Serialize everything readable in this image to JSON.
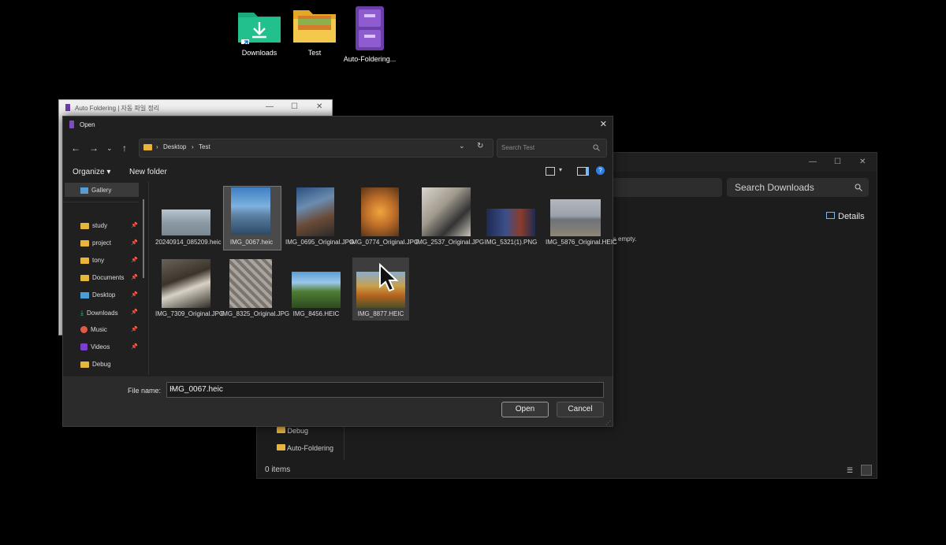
{
  "desktop": {
    "icons": [
      {
        "label": "Downloads",
        "icon": "downloads-folder-icon"
      },
      {
        "label": "Test",
        "icon": "folder-icon"
      },
      {
        "label": "Auto-Foldering...",
        "icon": "app-icon"
      }
    ]
  },
  "explorer": {
    "search_placeholder": "Search Downloads",
    "details_label": "Details",
    "empty_text": "is empty.",
    "sidebar": [
      "Debug",
      "Auto-Foldering"
    ],
    "status": "0 items"
  },
  "app_window": {
    "title": "Auto Foldering | 자동 파일 정리"
  },
  "dialog": {
    "title": "Open",
    "breadcrumb": [
      "Desktop",
      "Test"
    ],
    "search_placeholder": "Search Test",
    "organize_label": "Organize",
    "new_folder_label": "New folder",
    "sidebar": [
      {
        "label": "Gallery",
        "pinned": false
      },
      {
        "label": "study",
        "pinned": true
      },
      {
        "label": "project",
        "pinned": true
      },
      {
        "label": "tony",
        "pinned": true
      },
      {
        "label": "Documents",
        "pinned": true
      },
      {
        "label": "Desktop",
        "pinned": true
      },
      {
        "label": "Downloads",
        "pinned": true
      },
      {
        "label": "Music",
        "pinned": true
      },
      {
        "label": "Videos",
        "pinned": true
      },
      {
        "label": "Debug",
        "pinned": false
      }
    ],
    "files": [
      {
        "name": "20240914_085209.heic"
      },
      {
        "name": "IMG_0067.heic",
        "selected": true
      },
      {
        "name": "IMG_0695_Original.JPG"
      },
      {
        "name": "IMG_0774_Original.JPG"
      },
      {
        "name": "IMG_2537_Original.JPG"
      },
      {
        "name": "IMG_5321(1).PNG"
      },
      {
        "name": "IMG_5876_Original.HEIC"
      },
      {
        "name": "IMG_7309_Original.JPG"
      },
      {
        "name": "IMG_8325_Original.JPG"
      },
      {
        "name": "IMG_8456.HEIC"
      },
      {
        "name": "IMG_8877.HEIC",
        "hover": true
      }
    ],
    "file_name_label": "File name:",
    "file_name_value": "IMG_0067.heic",
    "open_label": "Open",
    "cancel_label": "Cancel"
  }
}
